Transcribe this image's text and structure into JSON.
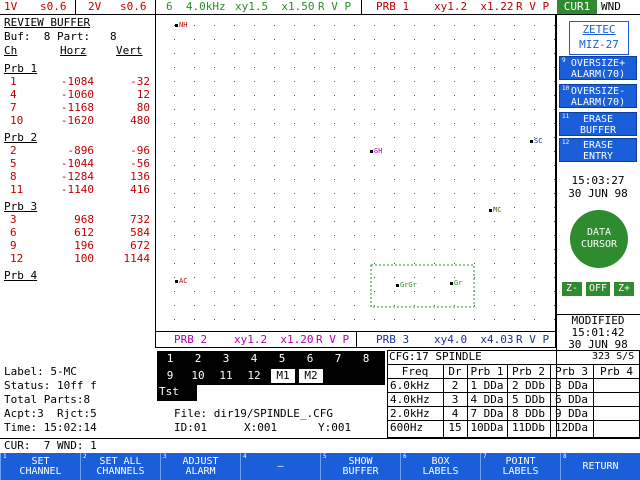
{
  "topbar": {
    "seg1": "1V",
    "seg2": "s0.6",
    "seg3": "2V",
    "seg4": "s0.6",
    "seg5": "6  4.0kHz",
    "seg6": "xy1.5  x1.50",
    "seg7": "R V P",
    "seg8": "PRB 1",
    "seg9": "xy1.2  x1.22",
    "seg10": "R V P",
    "cur": "CUR1",
    "wnd": "WND"
  },
  "left": {
    "title": "REVIEW BUFFER",
    "buf": "Buf:  8 Part:   8",
    "cols": [
      "Ch",
      "Horz",
      "Vert"
    ],
    "groups": [
      {
        "name": "Prb 1",
        "rows": [
          [
            "1",
            "-1084",
            "-32"
          ],
          [
            "4",
            "-1060",
            "12"
          ],
          [
            "7",
            "-1168",
            "80"
          ],
          [
            "10",
            "-1620",
            "480"
          ]
        ]
      },
      {
        "name": "Prb 2",
        "rows": [
          [
            "2",
            "-896",
            "-96"
          ],
          [
            "5",
            "-1044",
            "-56"
          ],
          [
            "8",
            "-1284",
            "136"
          ],
          [
            "11",
            "-1140",
            "416"
          ]
        ]
      },
      {
        "name": "Prb 3",
        "rows": [
          [
            "3",
            "968",
            "732"
          ],
          [
            "6",
            "612",
            "584"
          ],
          [
            "9",
            "196",
            "672"
          ],
          [
            "12",
            "100",
            "1144"
          ]
        ]
      },
      {
        "name": "Prb 4",
        "rows": []
      }
    ],
    "label": "Label: 5-MC",
    "status": "Status: 10ff f",
    "total": "Total Parts:8",
    "acpt": "Acpt:3  Rjct:5",
    "time": "Time: 15:02:14"
  },
  "scope": {
    "cursors": [
      {
        "name": "NH",
        "color": "#c00000"
      },
      {
        "name": "SH",
        "color": "#b000b0"
      },
      {
        "name": "SC",
        "color": "#1a2f9a"
      },
      {
        "name": "MC",
        "color": "#6b5a2a"
      },
      {
        "name": "AC",
        "color": "#c00000"
      },
      {
        "name": "GrGr",
        "color": "#2e8b2e"
      },
      {
        "name": "Gr",
        "color": "#2e8b2e"
      }
    ]
  },
  "scopebar": {
    "prb": "PRB 2",
    "xy": "xy1.2  x1.20",
    "rvp": "R V P",
    "prb3": "PRB 3",
    "xy3": "xy4.0  x4.03",
    "rvp3": "R V P"
  },
  "right": {
    "brand1": "ZETEC",
    "brand2": "MIZ-27",
    "buttons": [
      {
        "num": "9",
        "l1": "OVERSIZE+",
        "l2": "ALARM(70)"
      },
      {
        "num": "10",
        "l1": "OVERSIZE-",
        "l2": "ALARM(70)"
      },
      {
        "num": "11",
        "l1": "ERASE",
        "l2": "BUFFER"
      },
      {
        "num": "12",
        "l1": "ERASE",
        "l2": "ENTRY"
      }
    ],
    "clock_time": "15:03:27",
    "clock_date": "30 JUN 98",
    "data_cursor_l1": "DATA",
    "data_cursor_l2": "CURSOR",
    "zminus": "Z-",
    "off": "OFF",
    "zplus": "Z+",
    "modified": "MODIFIED",
    "mod_time": "15:01:42",
    "mod_date": "30 JUN 98"
  },
  "numgrid": {
    "row1": [
      "1",
      "2",
      "3",
      "4",
      "5",
      "6",
      "7",
      "8"
    ],
    "row2": [
      "9",
      "10",
      "11",
      "12",
      "M1",
      "M2"
    ],
    "tst": "Tst PF"
  },
  "file": {
    "file": "File: dir19/SPINDLE_.CFG",
    "id": "ID:01",
    "x": "X:001",
    "y": "Y:001"
  },
  "cfg": {
    "title": "CFG:17 SPINDLE",
    "rate": "323 S/S",
    "headers": [
      "Freq",
      "Dr",
      "Prb 1",
      "Prb 2",
      "Prb 3",
      "Prb 4"
    ],
    "rows": [
      [
        "6.0kHz",
        "2",
        "1 DDa",
        "2 DDb",
        "3 DDa",
        ""
      ],
      [
        "4.0kHz",
        "3",
        "4 DDa",
        "5 DDb",
        "6 DDa",
        ""
      ],
      [
        "2.0kHz",
        "4",
        "7 DDa",
        "8 DDb",
        "9 DDa",
        ""
      ],
      [
        "600Hz",
        "15",
        "10DDa",
        "11DDb",
        "12DDa",
        ""
      ]
    ]
  },
  "curline": "CUR:  7 WND: 1",
  "softkeys": [
    {
      "num": "1",
      "l1": "SET",
      "l2": "CHANNEL"
    },
    {
      "num": "2",
      "l1": "SET ALL",
      "l2": "CHANNELS"
    },
    {
      "num": "3",
      "l1": "ADJUST",
      "l2": "ALARM"
    },
    {
      "num": "4",
      "l1": "—",
      "l2": ""
    },
    {
      "num": "5",
      "l1": "SHOW",
      "l2": "BUFFER"
    },
    {
      "num": "6",
      "l1": "BOX",
      "l2": "LABELS"
    },
    {
      "num": "7",
      "l1": "POINT",
      "l2": "LABELS"
    },
    {
      "num": "8",
      "l1": "RETURN",
      "l2": ""
    }
  ],
  "colors": {
    "accent_blue": "#1a5fd9",
    "accent_green": "#2e8b2e",
    "value_red": "#c00000"
  }
}
